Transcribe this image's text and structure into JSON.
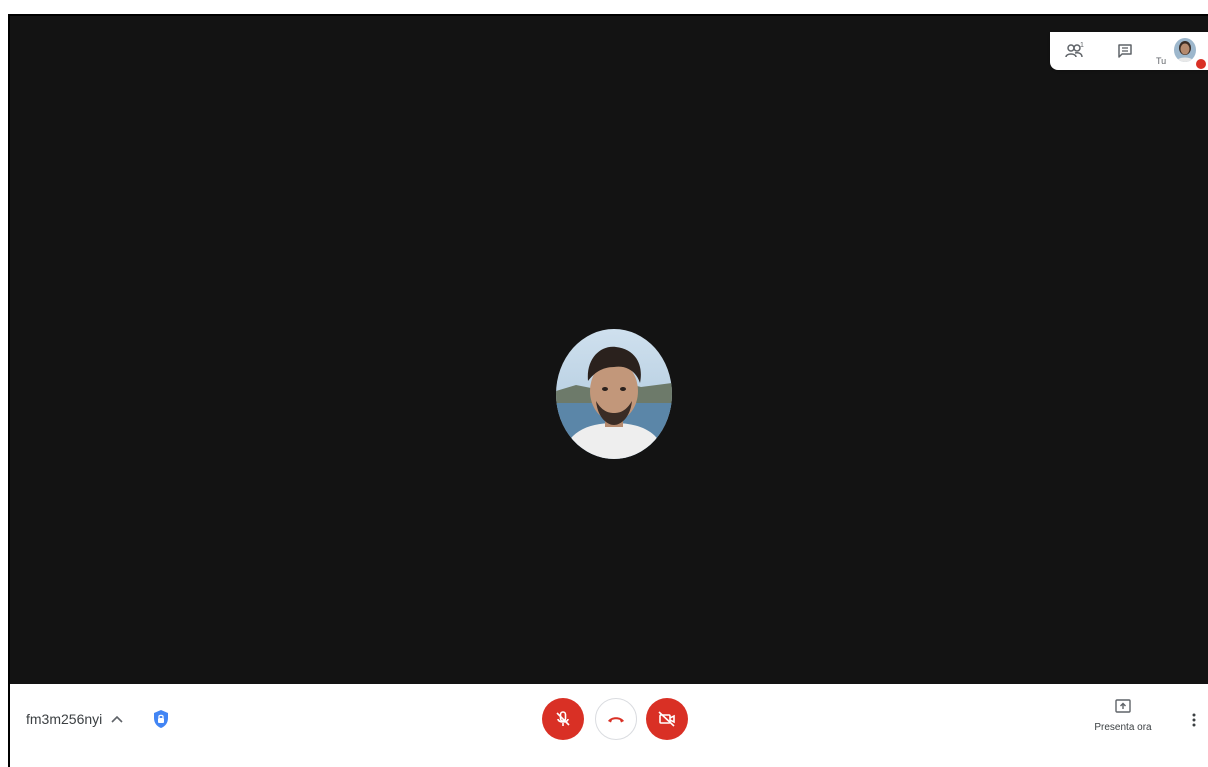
{
  "colors": {
    "stage_bg": "#131313",
    "bar_bg": "#ffffff",
    "danger": "#d93025",
    "icon_gray": "#5f6368",
    "text": "#3c4043",
    "shield_blue": "#4285f4"
  },
  "top_panel": {
    "people_icon": "people-icon",
    "people_count": "1",
    "chat_icon": "chat-icon",
    "self_label": "Tu",
    "self_avatar": "user-avatar"
  },
  "stage": {
    "participant_avatar": "participant-avatar"
  },
  "bottom_bar": {
    "meeting_code": "fm3m256nyi",
    "meeting_details_icon": "chevron-up-icon",
    "security_icon": "shield-lock-icon",
    "mic_icon": "mic-off-icon",
    "hangup_icon": "call-end-icon",
    "camera_icon": "videocam-off-icon",
    "present_icon": "present-to-all-icon",
    "present_label": "Presenta ora",
    "more_icon": "more-vert-icon"
  }
}
